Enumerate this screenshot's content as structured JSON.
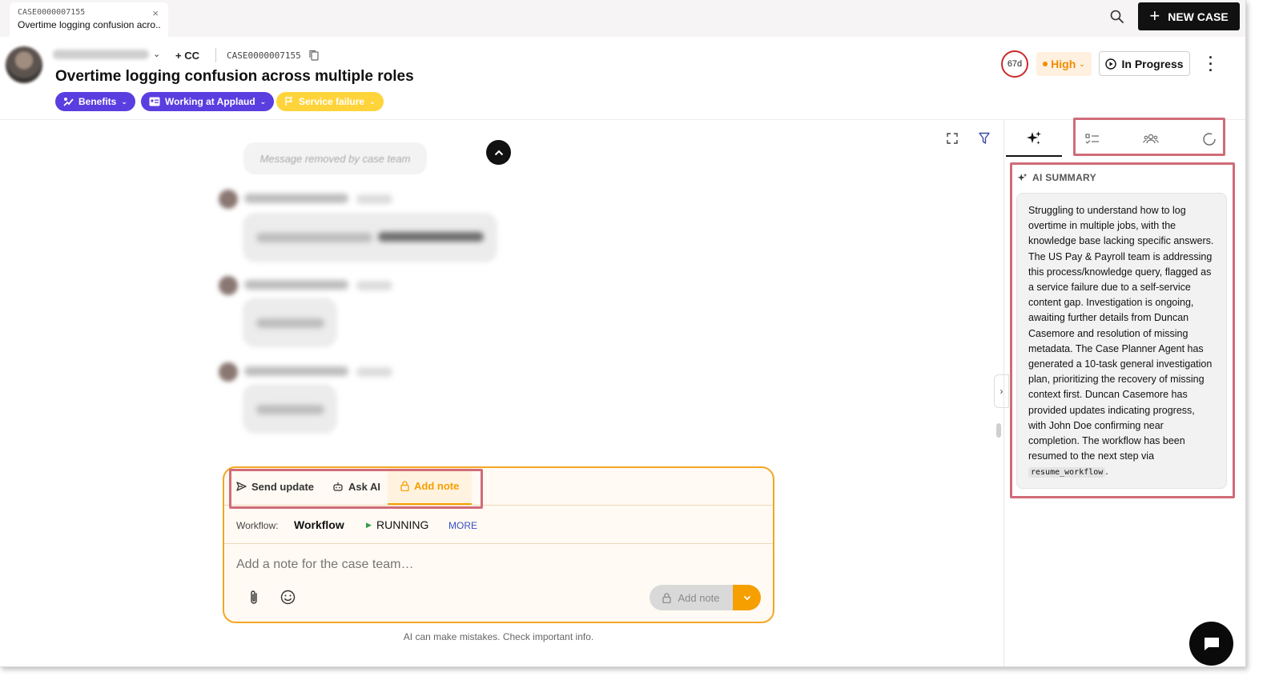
{
  "tab": {
    "case_number": "CASE0000007155",
    "title": "Overtime logging confusion acro...",
    "close": "×"
  },
  "topbar": {
    "new_case_label": "NEW CASE",
    "new_case_plus": "+"
  },
  "header": {
    "cc_label": "+ CC",
    "case_number": "CASE0000007155",
    "title": "Overtime logging confusion across multiple roles",
    "tags": [
      {
        "label": "Benefits",
        "color": "#5b3ee0"
      },
      {
        "label": "Working at Applaud",
        "color": "#5b3ee0"
      },
      {
        "label": "Service failure",
        "color": "#ffd43b"
      }
    ],
    "age": "67d",
    "priority": "High",
    "status": "In Progress"
  },
  "conversation": {
    "removed_message": "Message removed by case team"
  },
  "composer": {
    "tabs": [
      {
        "label": "Send update",
        "icon": "send-icon"
      },
      {
        "label": "Ask AI",
        "icon": "robot-icon"
      },
      {
        "label": "Add note",
        "icon": "lock-icon"
      }
    ],
    "workflow_label": "Workflow:",
    "workflow_name": "Workflow",
    "workflow_status": "RUNNING",
    "more_label": "MORE",
    "note_placeholder": "Add a note for the case team…",
    "add_note_button": "Add note"
  },
  "disclaimer": "AI can make mistakes. Check important info.",
  "right_panel": {
    "section_title": "AI SUMMARY",
    "summary_text": "Struggling to understand how to log overtime in multiple jobs, with the knowledge base lacking specific answers. The US Pay & Payroll team is addressing this process/knowledge query, flagged as a service failure due to a self-service content gap. Investigation is ongoing, awaiting further details from Duncan Casemore and resolution of missing metadata. The Case Planner Agent has generated a 10-task general investigation plan, prioritizing the recovery of missing context first. Duncan Casemore has provided updates indicating progress, with John Doe confirming near completion. The workflow has been resumed to the next step via ",
    "summary_code": "resume_workflow",
    "summary_end": "."
  },
  "colors": {
    "accent_orange": "#f59f00",
    "highlight_box": "#d06b78",
    "tag_purple": "#5b3ee0",
    "tag_yellow": "#ffd43b",
    "age_ring": "#c92a2a"
  }
}
